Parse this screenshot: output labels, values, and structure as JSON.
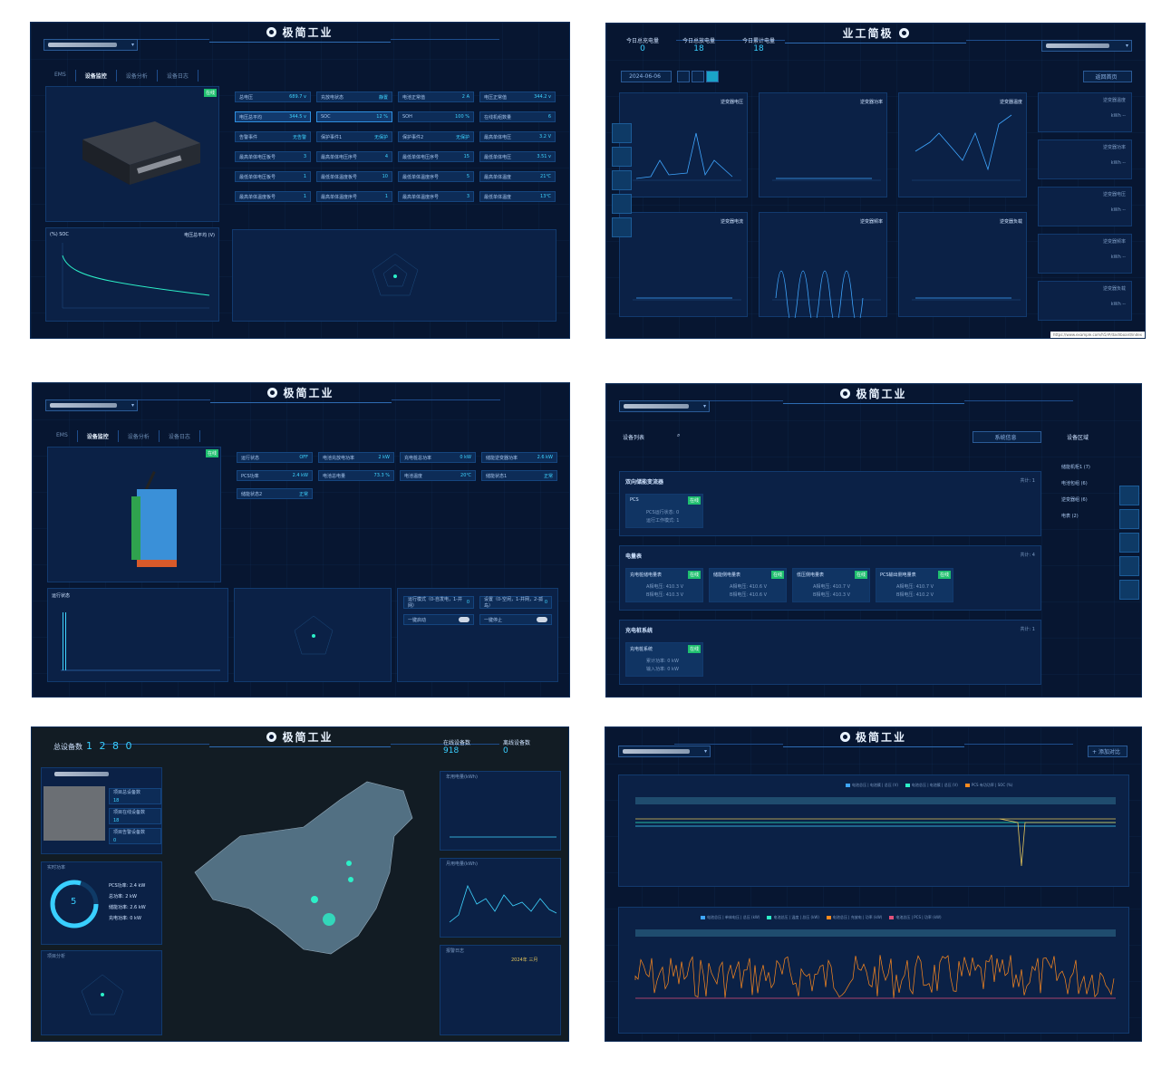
{
  "brand": "极简工业",
  "brand_flipped": "业工简极",
  "panel1": {
    "tabs": [
      "EMS",
      "设备监控",
      "设备分析",
      "设备日志"
    ],
    "active_tab": "设备监控",
    "badge": "在线",
    "cells": [
      [
        "总电压",
        "689.7 v"
      ],
      [
        "充放电状态",
        "静置"
      ],
      [
        "电池正常值",
        "2 A"
      ],
      [
        "电压正常值",
        "344.2 v"
      ],
      [
        "电压总平均",
        "344.5 v"
      ],
      [
        "SOC",
        "12 %"
      ],
      [
        "SOH",
        "100 %"
      ],
      [
        "在线机组数量",
        "6"
      ],
      [
        "告警事件",
        "无告警"
      ],
      [
        "保护事件1",
        "无保护"
      ],
      [
        "保护事件2",
        "无保护"
      ],
      [
        "最高单体电压",
        "3.2 V"
      ],
      [
        "最高单体电压板号",
        "3"
      ],
      [
        "最高单体电压序号",
        "4"
      ],
      [
        "最低单体电压序号",
        "15"
      ],
      [
        "最低单体电压",
        "3.51 v"
      ],
      [
        "最低单体电压板号",
        "1"
      ],
      [
        "最低单体温度板号",
        "10"
      ],
      [
        "最低单体温度序号",
        "5"
      ],
      [
        "最高单体温度",
        "21℃"
      ],
      [
        "最高单体温度板号",
        "1"
      ],
      [
        "最高单体温度序号",
        "1"
      ],
      [
        "最高单体温度序号",
        "3"
      ],
      [
        "最低单体温度",
        "13℃"
      ]
    ],
    "chart_legend_left": "(%) SOC",
    "chart_legend_right": "电压总平均 (V)"
  },
  "panel2": {
    "stats": [
      {
        "label": "今日总充电量",
        "value": "0"
      },
      {
        "label": "今日总放电量",
        "value": "18"
      },
      {
        "label": "今日累计电量",
        "value": "18"
      }
    ],
    "date": "2024-06-06",
    "btn": "返回首页",
    "charts": [
      "逆变器电压",
      "逆变器功率",
      "逆变器温度",
      "逆变器电流",
      "逆变器频率",
      "逆变器负载"
    ],
    "unit": "kWh --",
    "side_cards": [
      "逆变器温度",
      "逆变器功率",
      "逆变器电压",
      "逆变器频率",
      "逆变器负载"
    ],
    "url": "https://www.example.com/h5/#/dashboard/index"
  },
  "panel3": {
    "tabs": [
      "EMS",
      "设备监控",
      "设备分析",
      "设备日志"
    ],
    "badge": "在线",
    "cells": [
      [
        "运行状态",
        "OFF"
      ],
      [
        "电池充放电功率",
        "2 kW"
      ],
      [
        "充电桩总功率",
        "0 kW"
      ],
      [
        "储能逆变器功率",
        "2.6 kW"
      ],
      [
        "PCS功率",
        "2.4 kW"
      ],
      [
        "电池总电量",
        "73.3 %"
      ],
      [
        "电池温度",
        "20℃"
      ],
      [
        "储能状态1",
        "正常"
      ],
      [
        "储能状态2",
        "正常"
      ]
    ],
    "chart_legend": "运行状态",
    "ctrl": [
      {
        "label": "运行模式（0-自发电，1-并网）",
        "value": "0"
      },
      {
        "label": "设置（0-空闲，1-并网，2-孤岛）",
        "value": "0"
      },
      {
        "label": "一键启动"
      },
      {
        "label": "一键停止"
      }
    ]
  },
  "panel4": {
    "list_title": "设备列表",
    "sys_btn": "系统信息",
    "area_title": "设备区域",
    "areas": [
      "储能机柜1 (7)",
      "电池包组 (6)",
      "逆变器组 (6)",
      "电表 (2)"
    ],
    "sections": [
      {
        "title": "双向储能变流器",
        "count": "共计: 1",
        "cards": [
          {
            "name": "PCS",
            "lines": [
              "PCS运行状态: 0",
              "运行工作模式: 1"
            ]
          }
        ]
      },
      {
        "title": "电量表",
        "count": "共计: 4",
        "cards": [
          {
            "name": "充电桩储电量表",
            "lines": [
              "A相电压: 410.3 V",
              "B相电压: 410.3 V"
            ]
          },
          {
            "name": "储能侧电量表",
            "lines": [
              "A相电压: 410.6 V",
              "B相电压: 410.6 V"
            ]
          },
          {
            "name": "低压侧电量表",
            "lines": [
              "A相电压: 410.7 V",
              "B相电压: 410.3 V"
            ]
          },
          {
            "name": "PCS输出侧电量表",
            "lines": [
              "A相电压: 410.7 V",
              "B相电压: 410.2 V"
            ]
          }
        ]
      },
      {
        "title": "充电桩系统",
        "count": "共计: 1",
        "cards": [
          {
            "name": "充电桩系统",
            "lines": [
              "累计功率: 0 kW",
              "输入功率: 0 kW"
            ]
          }
        ]
      }
    ],
    "badge": "在线"
  },
  "panel5": {
    "total_label": "总设备数",
    "total": "1 2 8 0",
    "gauges": [
      {
        "label": "在线设备数",
        "value": "918"
      },
      {
        "label": "离线设备数",
        "value": "0"
      }
    ],
    "project": [
      "项目总设备数",
      "项目在线设备数",
      "项目告警设备数"
    ],
    "project_vals": [
      "18",
      "18",
      "0"
    ],
    "power_title": "实时功率",
    "power_center": "5",
    "power_list": [
      "PCS功率: 2.4 kW",
      "总功率: 2 kW",
      "储能功率: 2.6 kW",
      "充电功率: 0 kW"
    ],
    "radar_title": "项目分析",
    "chart1": "年用电量(kWh)",
    "chart2": "月用电量(kWh)",
    "alarm_title": "报警日志",
    "calendar_title": "2024年 三月"
  },
  "panel6": {
    "add_btn": "+ 添加对比",
    "legend1": [
      "电池总压 | 电池簇 | 总压 (V)",
      "电池总压 | 电池簇 | 总压 (V)",
      "PCS 有功功率 | SOC (%)"
    ],
    "legend2": [
      "电池总压 | 单体电压 | 总压 (kW)",
      "电池总压 | 温度 | 总压 (kW)",
      "电池总压 | 充放电 | 功率 (kW)",
      "电池总压 | PCS | 功率 (kW)"
    ]
  },
  "colors": {
    "bg": "#071631",
    "accent": "#3fd4ff",
    "teal": "#2cf0c8",
    "badge": "#1fbf6f",
    "orange": "#ff8a1e"
  }
}
